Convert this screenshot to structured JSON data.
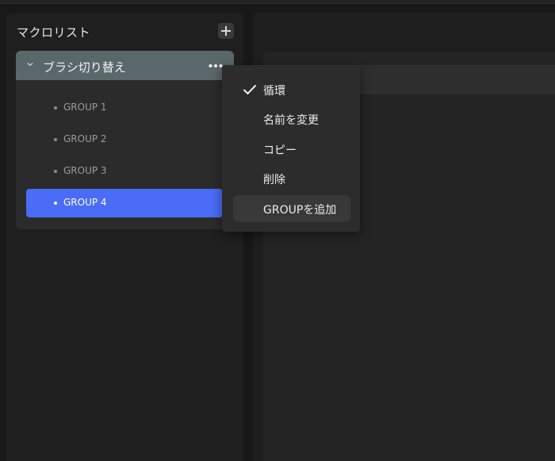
{
  "sidebar": {
    "title": "マクロリスト",
    "add_icon": "plus-icon",
    "macro": {
      "name": "ブラシ切り替え",
      "expand_icon": "chevron-down-icon",
      "more_icon": "more-horizontal-icon",
      "groups": [
        {
          "label": "GROUP 1",
          "selected": false
        },
        {
          "label": "GROUP 2",
          "selected": false
        },
        {
          "label": "GROUP 3",
          "selected": false
        },
        {
          "label": "GROUP 4",
          "selected": true
        }
      ]
    }
  },
  "context_menu": {
    "items": [
      {
        "label": "循環",
        "checked": true
      },
      {
        "label": "名前を変更",
        "checked": false
      },
      {
        "label": "コピー",
        "checked": false
      },
      {
        "label": "削除",
        "checked": false
      },
      {
        "label": "GROUPを追加",
        "checked": false,
        "hovered": true
      }
    ]
  },
  "colors": {
    "accent": "#4a6cf7",
    "header": "#5a676b",
    "background": "#181818"
  }
}
